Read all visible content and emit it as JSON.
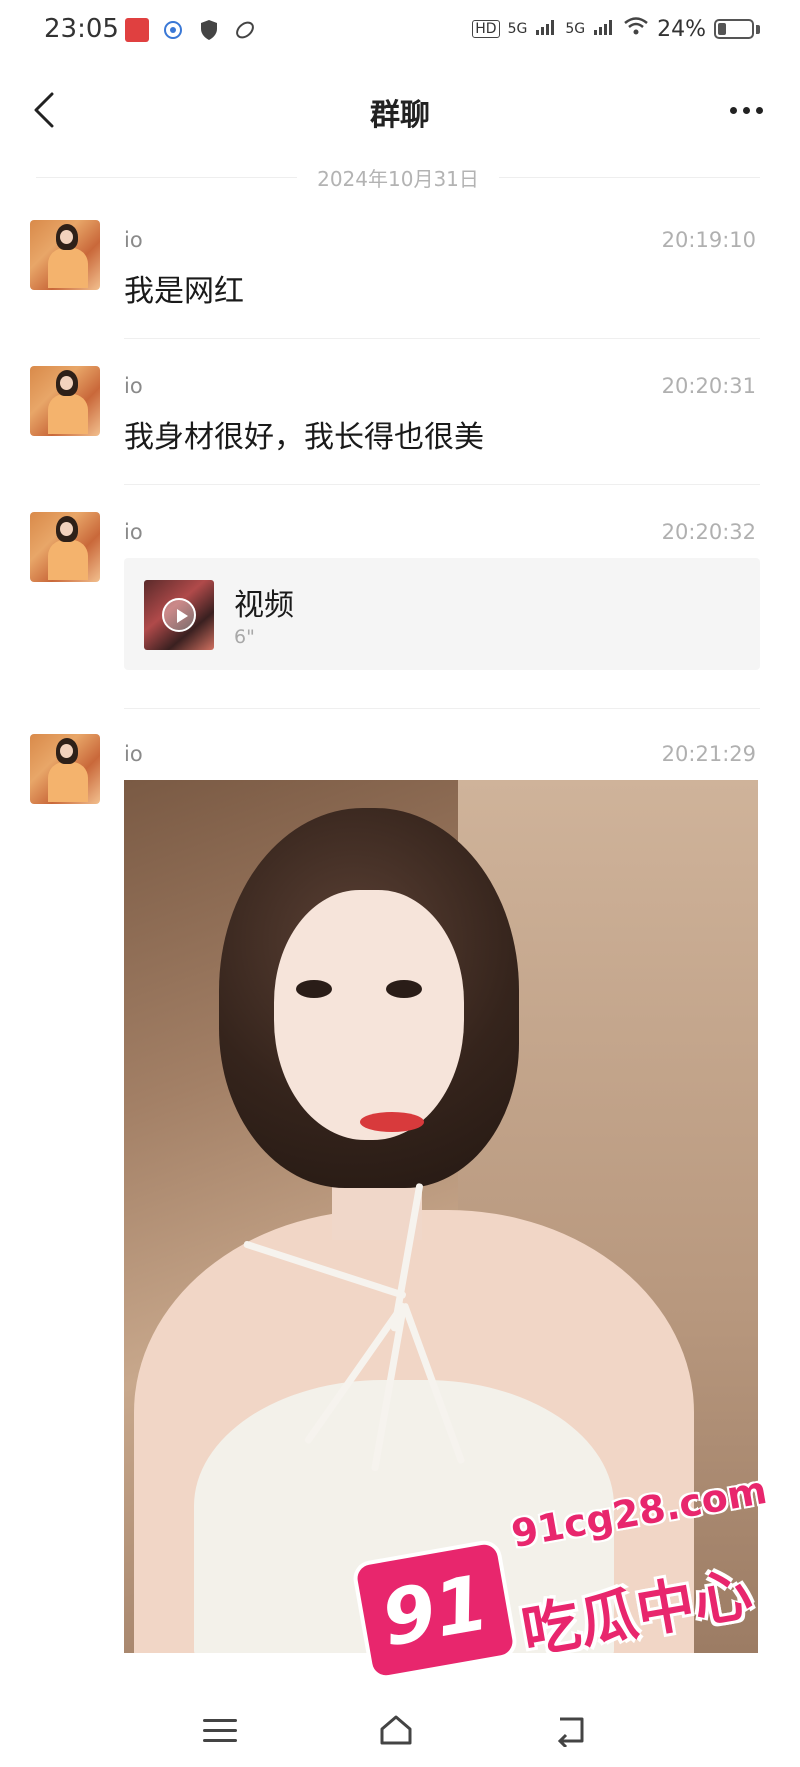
{
  "status_bar": {
    "time": "23:05",
    "network": "5G",
    "network2": "5G",
    "battery_text": "24%",
    "battery_level": 0.24
  },
  "nav": {
    "title": "群聊"
  },
  "date_divider": "2024年10月31日",
  "messages": [
    {
      "sender": "io",
      "time": "20:19:10",
      "type": "text",
      "text": "我是网红"
    },
    {
      "sender": "io",
      "time": "20:20:31",
      "type": "text",
      "text": "我身材很好，我长得也很美"
    },
    {
      "sender": "io",
      "time": "20:20:32",
      "type": "video",
      "label": "视频",
      "duration": "6\""
    },
    {
      "sender": "io",
      "time": "20:21:29",
      "type": "image"
    }
  ],
  "watermark": {
    "url": "91cg28.com",
    "badge": "91",
    "name": "吃瓜中心"
  },
  "colors": {
    "watermark_pink": "#e8266d",
    "bg": "#ffffff"
  }
}
